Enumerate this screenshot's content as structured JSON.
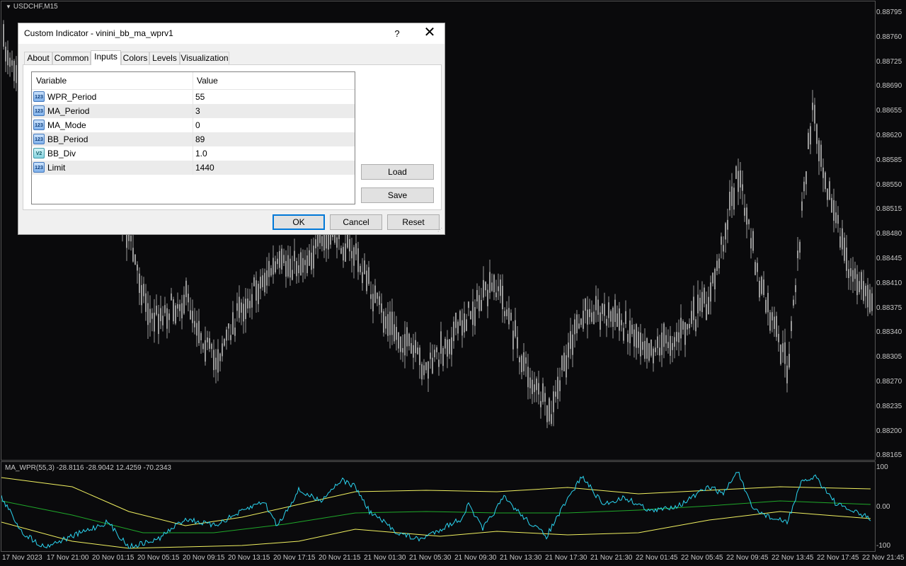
{
  "chart": {
    "symbol_label": "USDCHF,M15",
    "price_axis": [
      "0.88795",
      "0.88760",
      "0.88725",
      "0.88690",
      "0.88655",
      "0.88620",
      "0.88585",
      "0.88550",
      "0.88515",
      "0.88480",
      "0.88445",
      "0.88410",
      "0.88375",
      "0.88340",
      "0.88305",
      "0.88270",
      "0.88235",
      "0.88200",
      "0.88165"
    ],
    "time_axis": [
      "17 Nov 2023",
      "17 Nov 21:00",
      "20 Nov 01:15",
      "20 Nov 05:15",
      "20 Nov 09:15",
      "20 Nov 13:15",
      "20 Nov 17:15",
      "20 Nov 21:15",
      "21 Nov 01:30",
      "21 Nov 05:30",
      "21 Nov 09:30",
      "21 Nov 13:30",
      "21 Nov 17:30",
      "21 Nov 21:30",
      "22 Nov 01:45",
      "22 Nov 05:45",
      "22 Nov 09:45",
      "22 Nov 13:45",
      "22 Nov 17:45",
      "22 Nov 21:45"
    ],
    "indicator_label": "MA_WPR(55,3) -28.8116 -28.9042 12.4259 -70.2343",
    "indicator_axis": [
      "100",
      "0.00",
      "-100"
    ],
    "colors": {
      "background": "#0a0a0c",
      "candles": "#9a9a9a",
      "wpr_line": "#2ad4f0",
      "bb_band": "#f0f060",
      "bb_mid": "#1fa82a"
    }
  },
  "dialog": {
    "title": "Custom Indicator - vinini_bb_ma_wprv1",
    "help": "?",
    "tabs": [
      "About",
      "Common",
      "Inputs",
      "Colors",
      "Levels",
      "Visualization"
    ],
    "active_tab": "Inputs",
    "columns": {
      "variable": "Variable",
      "value": "Value"
    },
    "params": [
      {
        "icon": "int-icon",
        "icon_text": "123",
        "name": "WPR_Period",
        "value": "55"
      },
      {
        "icon": "int-icon",
        "icon_text": "123",
        "name": "MA_Period",
        "value": "3"
      },
      {
        "icon": "int-icon",
        "icon_text": "123",
        "name": "MA_Mode",
        "value": "0"
      },
      {
        "icon": "int-icon",
        "icon_text": "123",
        "name": "BB_Period",
        "value": "89"
      },
      {
        "icon": "double-icon",
        "icon_text": "V2",
        "name": "BB_Div",
        "value": "1.0"
      },
      {
        "icon": "int-icon",
        "icon_text": "123",
        "name": "Limit",
        "value": "1440"
      }
    ],
    "buttons": {
      "load": "Load",
      "save": "Save",
      "ok": "OK",
      "cancel": "Cancel",
      "reset": "Reset"
    }
  }
}
